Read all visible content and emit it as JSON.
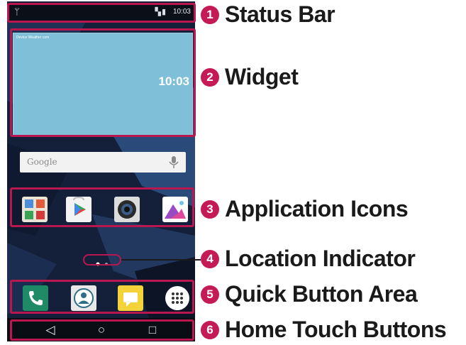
{
  "status_bar": {
    "time": "10:03",
    "left_icon": "usb-icon",
    "right_icons": "signal-wifi-battery"
  },
  "widget": {
    "time": "10:03",
    "header": "Device Weather com"
  },
  "search": {
    "placeholder": "Google",
    "icon": "mic-icon"
  },
  "apps": [
    {
      "name": "folder-icon"
    },
    {
      "name": "play-store-icon"
    },
    {
      "name": "camera-icon"
    },
    {
      "name": "gallery-icon"
    }
  ],
  "pager": {
    "page": 1,
    "total": 2
  },
  "dock": [
    {
      "name": "phone-icon",
      "color": "#1e8a66"
    },
    {
      "name": "contacts-icon",
      "color": "#e8e8e8"
    },
    {
      "name": "messages-icon",
      "color": "#f4d23a"
    },
    {
      "name": "apps-drawer-icon",
      "color": "#ffffff"
    }
  ],
  "nav": {
    "back": "◁",
    "home": "○",
    "recent": "□"
  },
  "callouts": [
    {
      "num": "1",
      "label": "Status Bar"
    },
    {
      "num": "2",
      "label": "Widget"
    },
    {
      "num": "3",
      "label": "Application Icons"
    },
    {
      "num": "4",
      "label": "Location Indicator"
    },
    {
      "num": "5",
      "label": "Quick Button Area"
    },
    {
      "num": "6",
      "label": "Home Touch Buttons"
    }
  ],
  "colors": {
    "callout": "#c41a56",
    "wallpaper": "#15213a",
    "widget": "#7fbfd8"
  }
}
